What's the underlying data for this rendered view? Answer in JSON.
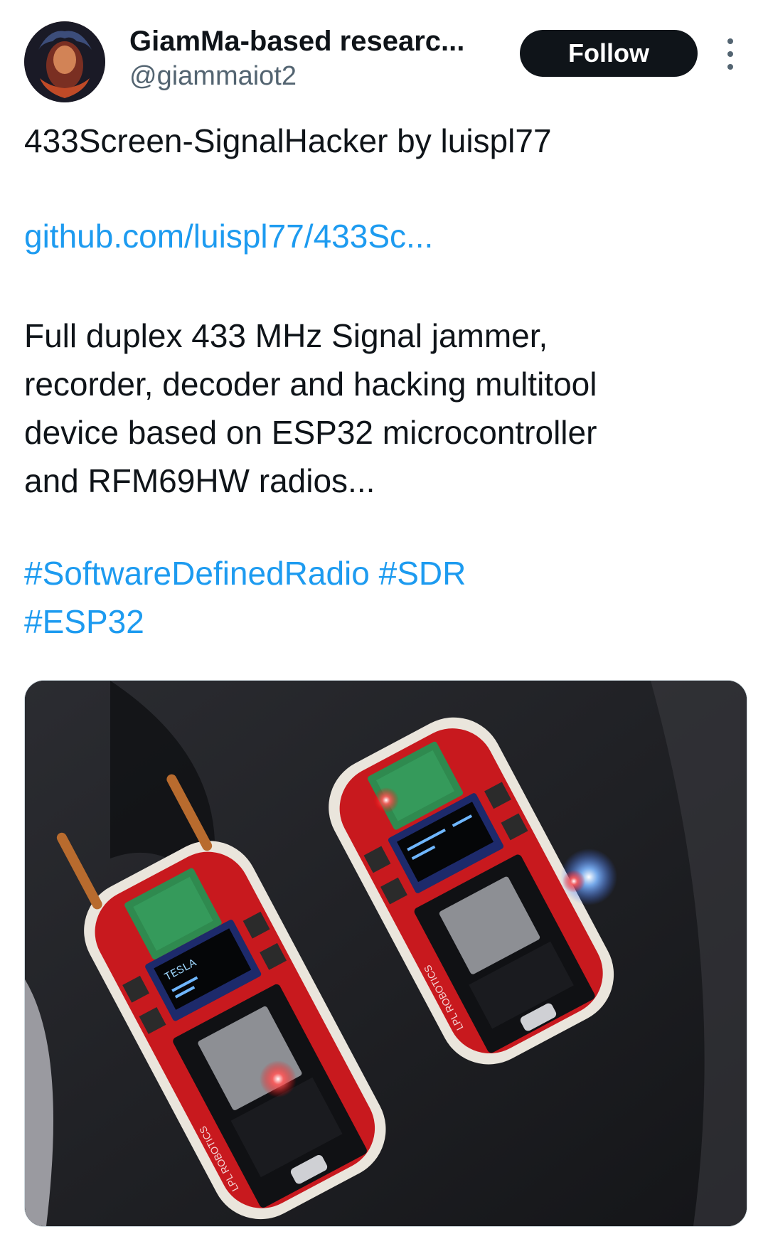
{
  "tweet": {
    "author": {
      "display_name": "GiamMa-based researc...",
      "handle": "@giammaiot2"
    },
    "follow_label": "Follow",
    "more_icon": "more-vertical-icon",
    "title_line": "433Screen-SignalHacker by luispl77",
    "link": "github.com/luispl77/433Sc...",
    "body_lines": [
      "Full duplex 433 MHz Signal jammer,",
      "recorder, decoder and hacking multitool",
      "device based on ESP32 microcontroller",
      "and RFM69HW radios..."
    ],
    "hashtags_line1": "#SoftwareDefinedRadio #SDR",
    "hashtags_line2": "#ESP32",
    "image": {
      "left_screen_title": "TESLA",
      "left_board_label": "LPL ROBOTICS",
      "right_board_label": "LPL ROBOTICS"
    }
  },
  "colors": {
    "link": "#1d9bf0",
    "text": "#0f1419",
    "secondary": "#536471",
    "button_bg": "#0f1419",
    "pcb_red": "#c8191e"
  }
}
